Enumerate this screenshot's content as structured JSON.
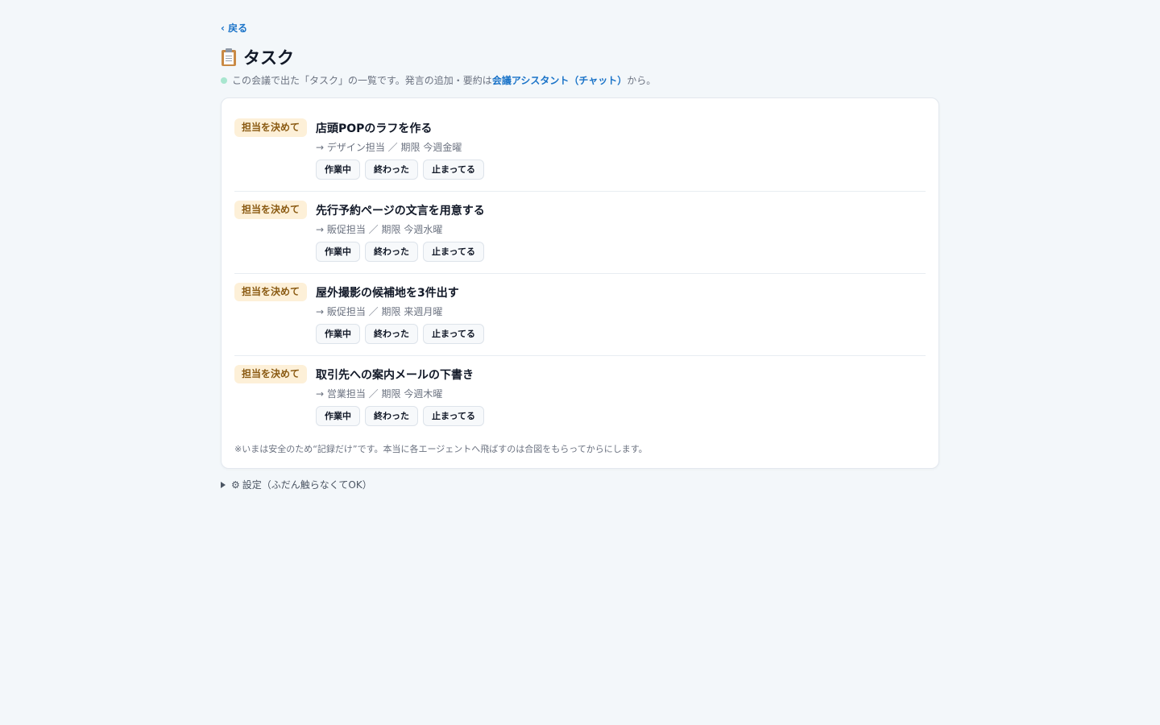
{
  "nav": {
    "back_label": "‹ 戻る"
  },
  "header": {
    "title": "タスク",
    "title_icon": "clipboard-icon",
    "subtitle_prefix": "この会議で出た「タスク」の一覧です。発言の追加・要約は",
    "subtitle_link": "会議アシスタント（チャット）",
    "subtitle_suffix": "から。"
  },
  "tasks": [
    {
      "badge": "担当を決めて",
      "title": "店頭POPのラフを作る",
      "meta": "→ デザイン担当 ／ 期限 今週金曜",
      "status_buttons": [
        "作業中",
        "終わった",
        "止まってる"
      ]
    },
    {
      "badge": "担当を決めて",
      "title": "先行予約ページの文言を用意する",
      "meta": "→ 販促担当 ／ 期限 今週水曜",
      "status_buttons": [
        "作業中",
        "終わった",
        "止まってる"
      ]
    },
    {
      "badge": "担当を決めて",
      "title": "屋外撮影の候補地を3件出す",
      "meta": "→ 販促担当 ／ 期限 来週月曜",
      "status_buttons": [
        "作業中",
        "終わった",
        "止まってる"
      ]
    },
    {
      "badge": "担当を決めて",
      "title": "取引先への案内メールの下書き",
      "meta": "→ 営業担当 ／ 期限 今週木曜",
      "status_buttons": [
        "作業中",
        "終わった",
        "止まってる"
      ]
    }
  ],
  "footnote": "※いまは安全のため“記録だけ”です。本当に各エージェントへ飛ばすのは合図をもらってからにします。",
  "settings": {
    "label": "設定（ふだん触らなくてOK）",
    "icon": "gear-icon"
  },
  "colors": {
    "background": "#f3f7fa",
    "accent": "#1a73c8",
    "badge_bg": "#fdf0d8",
    "badge_text": "#8a5a12",
    "status_dot": "#a8e6cf"
  }
}
